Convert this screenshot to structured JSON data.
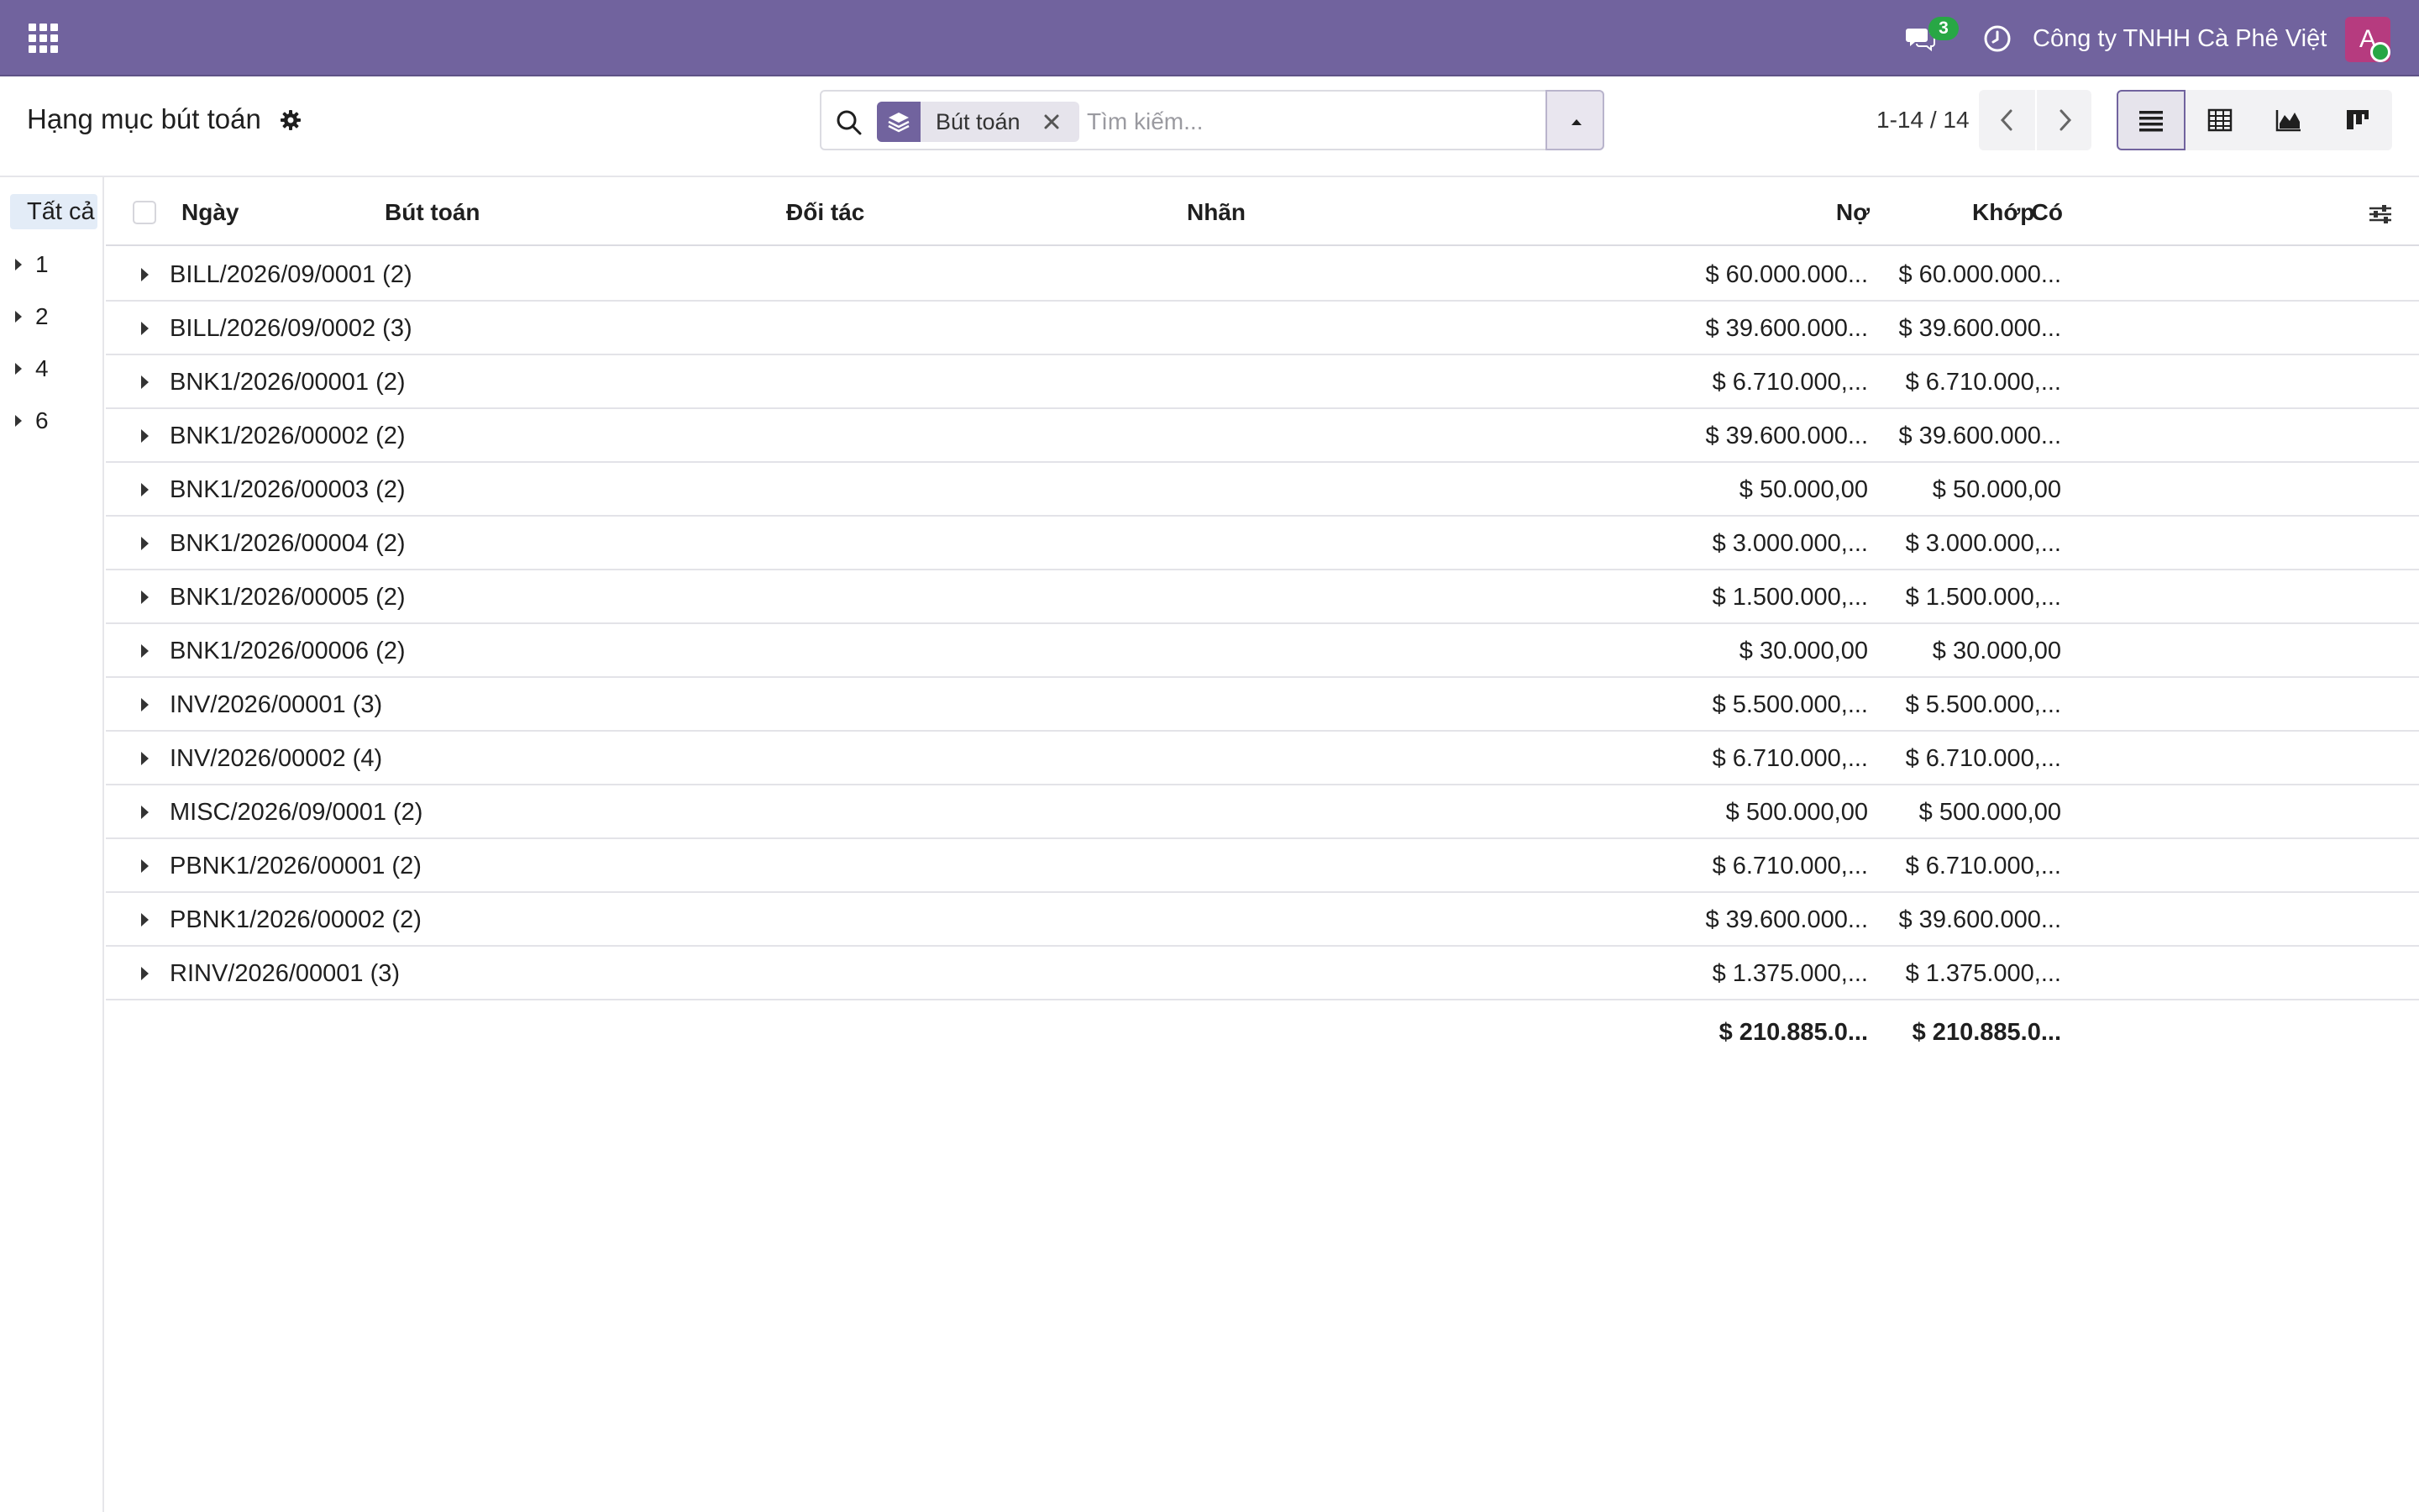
{
  "navbar": {
    "company": "Công ty TNHH Cà Phê Việt",
    "chat_count": "3",
    "avatar_letter": "A",
    "bg_color": "#71639e"
  },
  "control_panel": {
    "title": "Hạng mục bút toán",
    "search": {
      "facet_label": "Bút toán",
      "placeholder": "Tìm kiếm..."
    },
    "pager": "1-14 / 14"
  },
  "side_panel": {
    "all_label": "Tất cả",
    "items": [
      "1",
      "2",
      "4",
      "6"
    ]
  },
  "table": {
    "columns": {
      "date": "Ngày",
      "move": "Bút toán",
      "partner": "Đối tác",
      "label": "Nhãn",
      "debit": "Nợ",
      "credit": "Có",
      "matching": "Khớp"
    },
    "groups": [
      {
        "name": "BILL/2026/09/0001 (2)",
        "debit": "$ 60.000.000...",
        "credit": "$ 60.000.000..."
      },
      {
        "name": "BILL/2026/09/0002 (3)",
        "debit": "$ 39.600.000...",
        "credit": "$ 39.600.000..."
      },
      {
        "name": "BNK1/2026/00001 (2)",
        "debit": "$ 6.710.000,...",
        "credit": "$ 6.710.000,..."
      },
      {
        "name": "BNK1/2026/00002 (2)",
        "debit": "$ 39.600.000...",
        "credit": "$ 39.600.000..."
      },
      {
        "name": "BNK1/2026/00003 (2)",
        "debit": "$ 50.000,00",
        "credit": "$ 50.000,00"
      },
      {
        "name": "BNK1/2026/00004 (2)",
        "debit": "$ 3.000.000,...",
        "credit": "$ 3.000.000,..."
      },
      {
        "name": "BNK1/2026/00005 (2)",
        "debit": "$ 1.500.000,...",
        "credit": "$ 1.500.000,..."
      },
      {
        "name": "BNK1/2026/00006 (2)",
        "debit": "$ 30.000,00",
        "credit": "$ 30.000,00"
      },
      {
        "name": "INV/2026/00001 (3)",
        "debit": "$ 5.500.000,...",
        "credit": "$ 5.500.000,..."
      },
      {
        "name": "INV/2026/00002 (4)",
        "debit": "$ 6.710.000,...",
        "credit": "$ 6.710.000,..."
      },
      {
        "name": "MISC/2026/09/0001 (2)",
        "debit": "$ 500.000,00",
        "credit": "$ 500.000,00"
      },
      {
        "name": "PBNK1/2026/00001 (2)",
        "debit": "$ 6.710.000,...",
        "credit": "$ 6.710.000,..."
      },
      {
        "name": "PBNK1/2026/00002 (2)",
        "debit": "$ 39.600.000...",
        "credit": "$ 39.600.000..."
      },
      {
        "name": "RINV/2026/00001 (3)",
        "debit": "$ 1.375.000,...",
        "credit": "$ 1.375.000,..."
      }
    ],
    "totals": {
      "debit": "$ 210.885.0...",
      "credit": "$ 210.885.0..."
    }
  }
}
